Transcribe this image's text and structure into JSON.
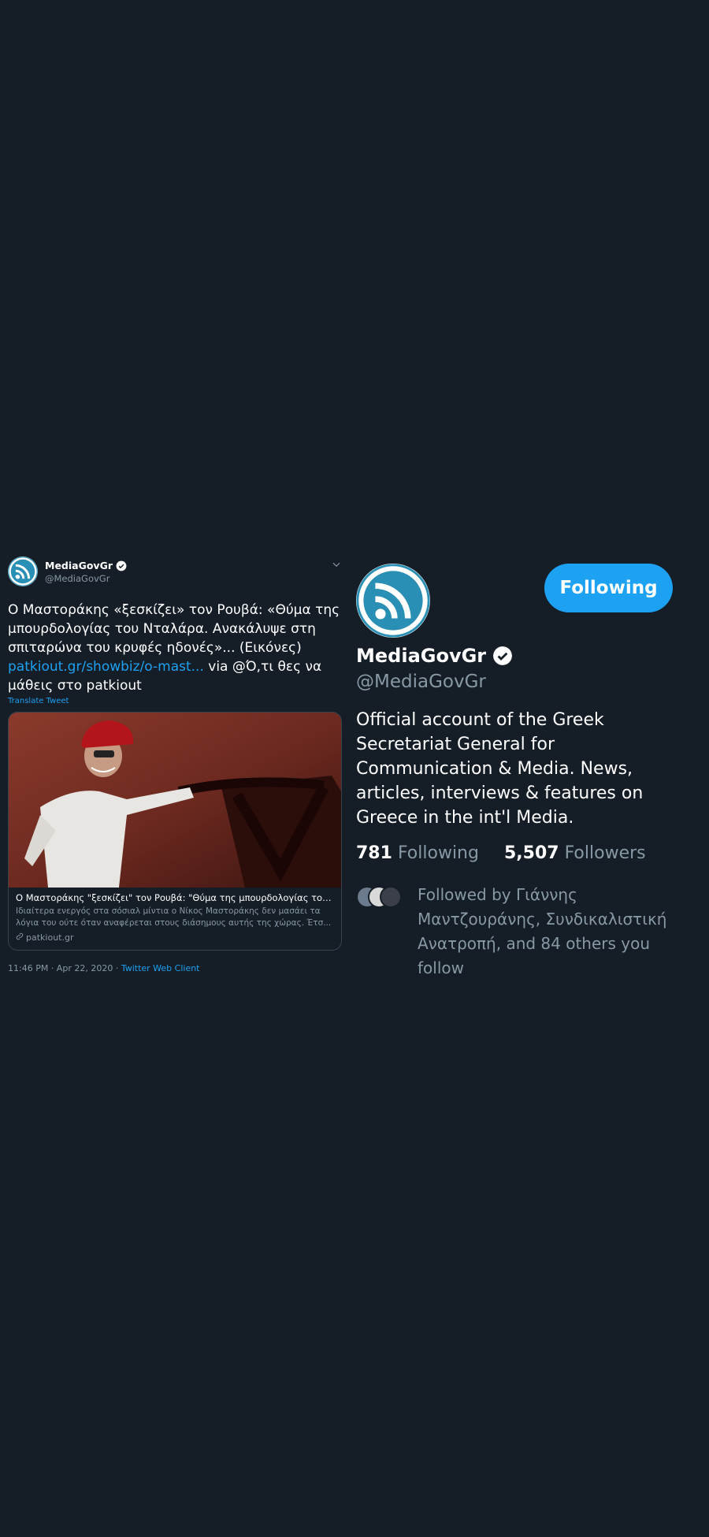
{
  "tweet": {
    "author_name": "MediaGovGr",
    "author_handle": "@MediaGovGr",
    "text_main": "Ο Μαστοράκης «ξεσκίζει» τον Ρουβά: «Θύμα της μπουρδολογίας του Νταλάρα. Ανακάλυψε στη σπιταρώνα του κρυφές ηδονές»... (Εικόνες)",
    "text_link": "patkiout.gr/showbiz/o-mast...",
    "text_tail": " via @Ό,τι θες να μάθεις στο patkiout",
    "translate_label": "Translate Tweet",
    "card_title": "Ο Μαστοράκης \"ξεσκίζει\" τον Ρουβά: \"Θύμα της μπουρδολογίας του Νταλάρα...",
    "card_description": "Ιδιαίτερα ενεργός στα σόσιαλ μίντια ο Νίκος Μαστοράκης δεν μασάει τα λόγια του ούτε όταν αναφέρεται στους διάσημους αυτής της χώρας. Έτσ...",
    "card_domain": "patkiout.gr",
    "timestamp": "11:46 PM · Apr 22, 2020 · ",
    "client": "Twitter Web Client"
  },
  "profile": {
    "name": "MediaGovGr",
    "handle": "@MediaGovGr",
    "follow_button": "Following",
    "bio": "Official account of the Greek Secretariat General for Communication & Media. News, articles, interviews & features on Greece in the int'l Media.",
    "following_count": "781",
    "following_label": "Following",
    "followers_count": "5,507",
    "followers_label": "Followers",
    "followed_by": "Followed by Γιάννης Μαντζουράνης, Συνδικαλιστική Ανατροπή, and 84 others you follow"
  },
  "colors": {
    "background": "#151d27",
    "accent": "#1da1f2",
    "secondary_text": "#8899a6"
  },
  "icons": [
    "verified-badge-icon",
    "chevron-down-icon",
    "link-icon",
    "avatar-rss-logo"
  ]
}
